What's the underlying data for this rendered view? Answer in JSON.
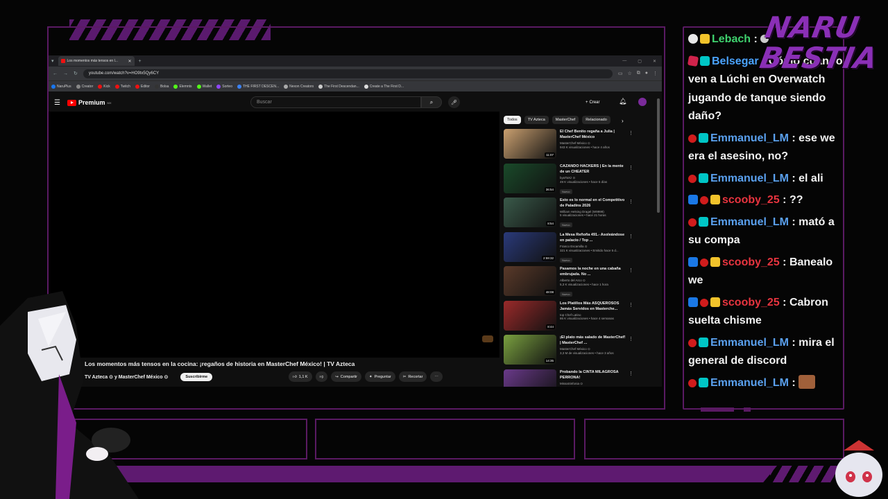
{
  "browser": {
    "tab_title": "Los momentos más tensos en l...",
    "url": "youtube.com/watch?v=HO9tx5Qy6CY",
    "bookmarks": [
      "NaruPlus",
      "Creator",
      "Kick",
      "Twitch",
      "Editor",
      "Bolsa",
      "Elemnts",
      "Wallet",
      "Sorteo",
      "THE FIRST DESCEN...",
      "Nexon Creators",
      "The First Descendan...",
      "Create a The First D..."
    ]
  },
  "youtube": {
    "logo_text": "Premium",
    "logo_region": "MX",
    "search_placeholder": "Buscar",
    "create_label": "Crear",
    "video_title": "Los momentos más tensos en la cocina: ¡regaños de historia en MasterChef México! | TV Azteca",
    "channel": "TV Azteca ⊙ y MasterChef México ⊙",
    "subscribe": "Suscribirme",
    "likes": "1,1 K",
    "share": "Compartir",
    "ask": "Preguntar",
    "clip": "Recortar",
    "chips": [
      "Todos",
      "TV Azteca",
      "MasterChef",
      "Relacionado"
    ],
    "recommendations": [
      {
        "title": "El Chef Benito regaña a Julia | MasterChef México",
        "channel": "MasterChef México ⊙",
        "views": "943 K visualizaciones • hace 4 años",
        "duration": "11:07",
        "badge": "",
        "color": "#caa070"
      },
      {
        "title": "CAZANDO HACKERS | En la mente de un CHEATER",
        "channel": "byaTaXz ⊙",
        "views": "49 K visualizaciones • hace 5 días",
        "duration": "36:54",
        "badge": "Nuevo",
        "color": "#1a4a2a"
      },
      {
        "title": "Esto es lo normal en el Competitivo de Paladins 2026",
        "channel": "William Helsing Dragel (W9999)",
        "views": "5 visualizaciones • hace 21 horas",
        "duration": "8:54",
        "badge": "Nuevo",
        "color": "#3a5a4a"
      },
      {
        "title": "La Mesa Reñoña 491.- Asoleándose en palacio / Top ...",
        "channel": "Franco Escamilla ⊙",
        "views": "321 K visualizaciones • Emitido hace 5 d...",
        "duration": "2:59:32",
        "badge": "Nuevo",
        "color": "#2a3a7a"
      },
      {
        "title": "Pasamos la noche en una cabaña embrujada. No ...",
        "channel": "Alberto del Arco ⊙",
        "views": "5,3 K visualizaciones • hace 1 hora",
        "duration": "48:08",
        "badge": "Nuevo",
        "color": "#5a3a2a"
      },
      {
        "title": "Los Platillos Más ASQUEROSOS Jamás Servidos en Masterche...",
        "channel": "top Chef Latino",
        "views": "86 K visualizaciones • hace 4 semanas",
        "duration": "8:44",
        "badge": "",
        "color": "#9a2a2a"
      },
      {
        "title": "¡El plato más salado de MasterChef! | MasterChef ...",
        "channel": "MasterChef México ⊙",
        "views": "3,3 M de visualizaciones • hace 3 años",
        "duration": "14:35",
        "badge": "",
        "color": "#7aa040"
      },
      {
        "title": "Probando la CINTA MILAGROSA PERRONA!",
        "channel": "MissaSinfonia ⊙",
        "views": "",
        "duration": "",
        "badge": "",
        "color": "#6a3a8a"
      }
    ]
  },
  "chat": {
    "brand": "NARU BESTIA",
    "messages": [
      {
        "user": "Lebach",
        "color": "#3fd26e",
        "badges": [
          "white",
          "crown"
        ],
        "text": " : ",
        "emote": true
      },
      {
        "user": "Belsegar",
        "color": "#4aa3ff",
        "badges": [
          "dice",
          "bars"
        ],
        "text": " : Cómo cuando ven a Lúchi en Overwatch jugando de tanque siendo daño?",
        "emote": false
      },
      {
        "user": "Emmanuel_LM",
        "color": "#5aa0ee",
        "badges": [
          "red",
          "bars"
        ],
        "text": " : ese we era el asesino, no?",
        "emote": false
      },
      {
        "user": "Emmanuel_LM",
        "color": "#5aa0ee",
        "badges": [
          "red",
          "bars"
        ],
        "text": " : el ali",
        "emote": false
      },
      {
        "user": "scooby_25",
        "color": "#e8343f",
        "badges": [
          "blue",
          "red",
          "crown"
        ],
        "text": " : ??",
        "emote": false
      },
      {
        "user": "Emmanuel_LM",
        "color": "#5aa0ee",
        "badges": [
          "red",
          "bars"
        ],
        "text": " : mató a su compa",
        "emote": false
      },
      {
        "user": "scooby_25",
        "color": "#e8343f",
        "badges": [
          "blue",
          "red",
          "crown"
        ],
        "text": " : Banealo we",
        "emote": false
      },
      {
        "user": "scooby_25",
        "color": "#e8343f",
        "badges": [
          "blue",
          "red",
          "crown"
        ],
        "text": " : Cabron suelta chisme",
        "emote": false
      },
      {
        "user": "Emmanuel_LM",
        "color": "#5aa0ee",
        "badges": [
          "red",
          "bars"
        ],
        "text": " : mira el general de discord",
        "emote": false
      },
      {
        "user": "Emmanuel_LM",
        "color": "#5aa0ee",
        "badges": [
          "red",
          "bars"
        ],
        "text": " : ",
        "emote": true
      }
    ]
  }
}
